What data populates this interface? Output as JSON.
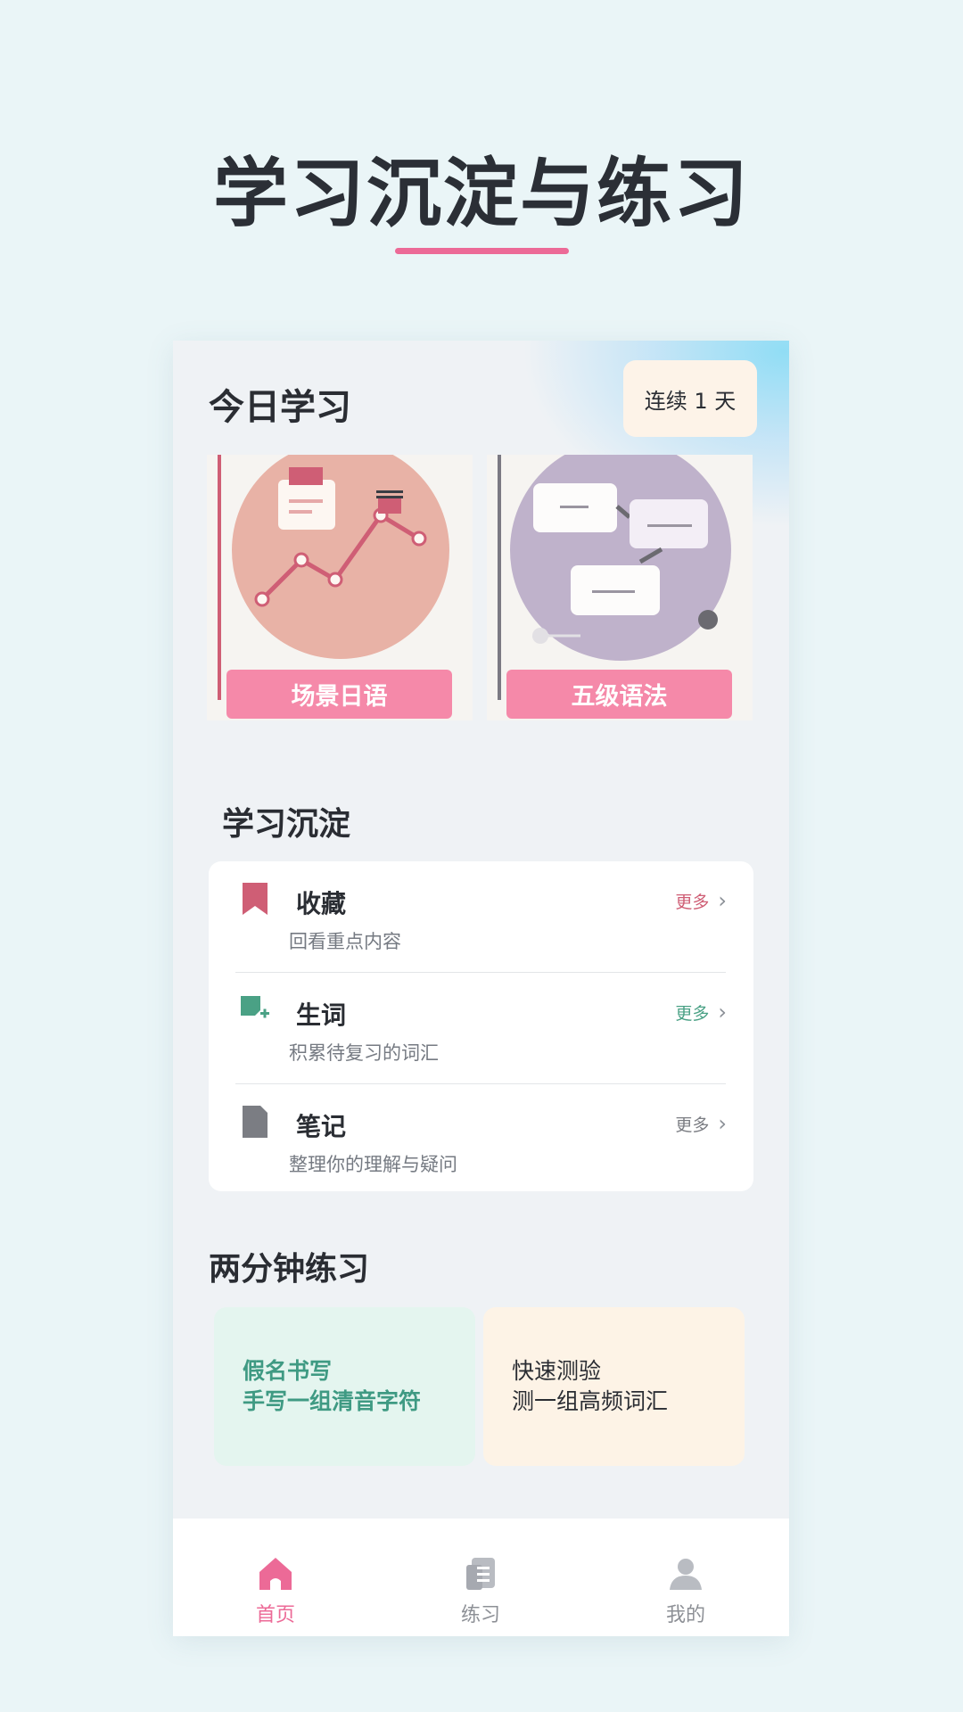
{
  "promo": {
    "title": "学习沉淀与练习"
  },
  "header": {
    "title": "今日学习",
    "streak": "连续 1 天"
  },
  "courses": [
    {
      "label": "场景日语",
      "icon": "line-chart-icon"
    },
    {
      "label": "五级语法",
      "icon": "grammar-nodes-icon"
    }
  ],
  "accumulation": {
    "title": "学习沉淀",
    "items": [
      {
        "title": "收藏",
        "desc": "回看重点内容",
        "more": "更多",
        "icon": "bookmark-icon",
        "color": "#cf5e75"
      },
      {
        "title": "生词",
        "desc": "积累待复习的词汇",
        "more": "更多",
        "icon": "add-word-icon",
        "color": "#4aa185"
      },
      {
        "title": "笔记",
        "desc": "整理你的理解与疑问",
        "more": "更多",
        "icon": "note-icon",
        "color": "#7b7d83"
      }
    ]
  },
  "practice": {
    "title": "两分钟练习",
    "cards": [
      {
        "title": "假名书写",
        "desc": "手写一组清音字符"
      },
      {
        "title": "快速测验",
        "desc": "测一组高频词汇"
      }
    ]
  },
  "tabs": [
    {
      "label": "首页",
      "icon": "home-icon",
      "active": true
    },
    {
      "label": "练习",
      "icon": "practice-icon",
      "active": false
    },
    {
      "label": "我的",
      "icon": "profile-icon",
      "active": false
    }
  ],
  "colors": {
    "accent": "#ec6a97",
    "green": "#4aa185",
    "inactive": "#8d9096"
  }
}
